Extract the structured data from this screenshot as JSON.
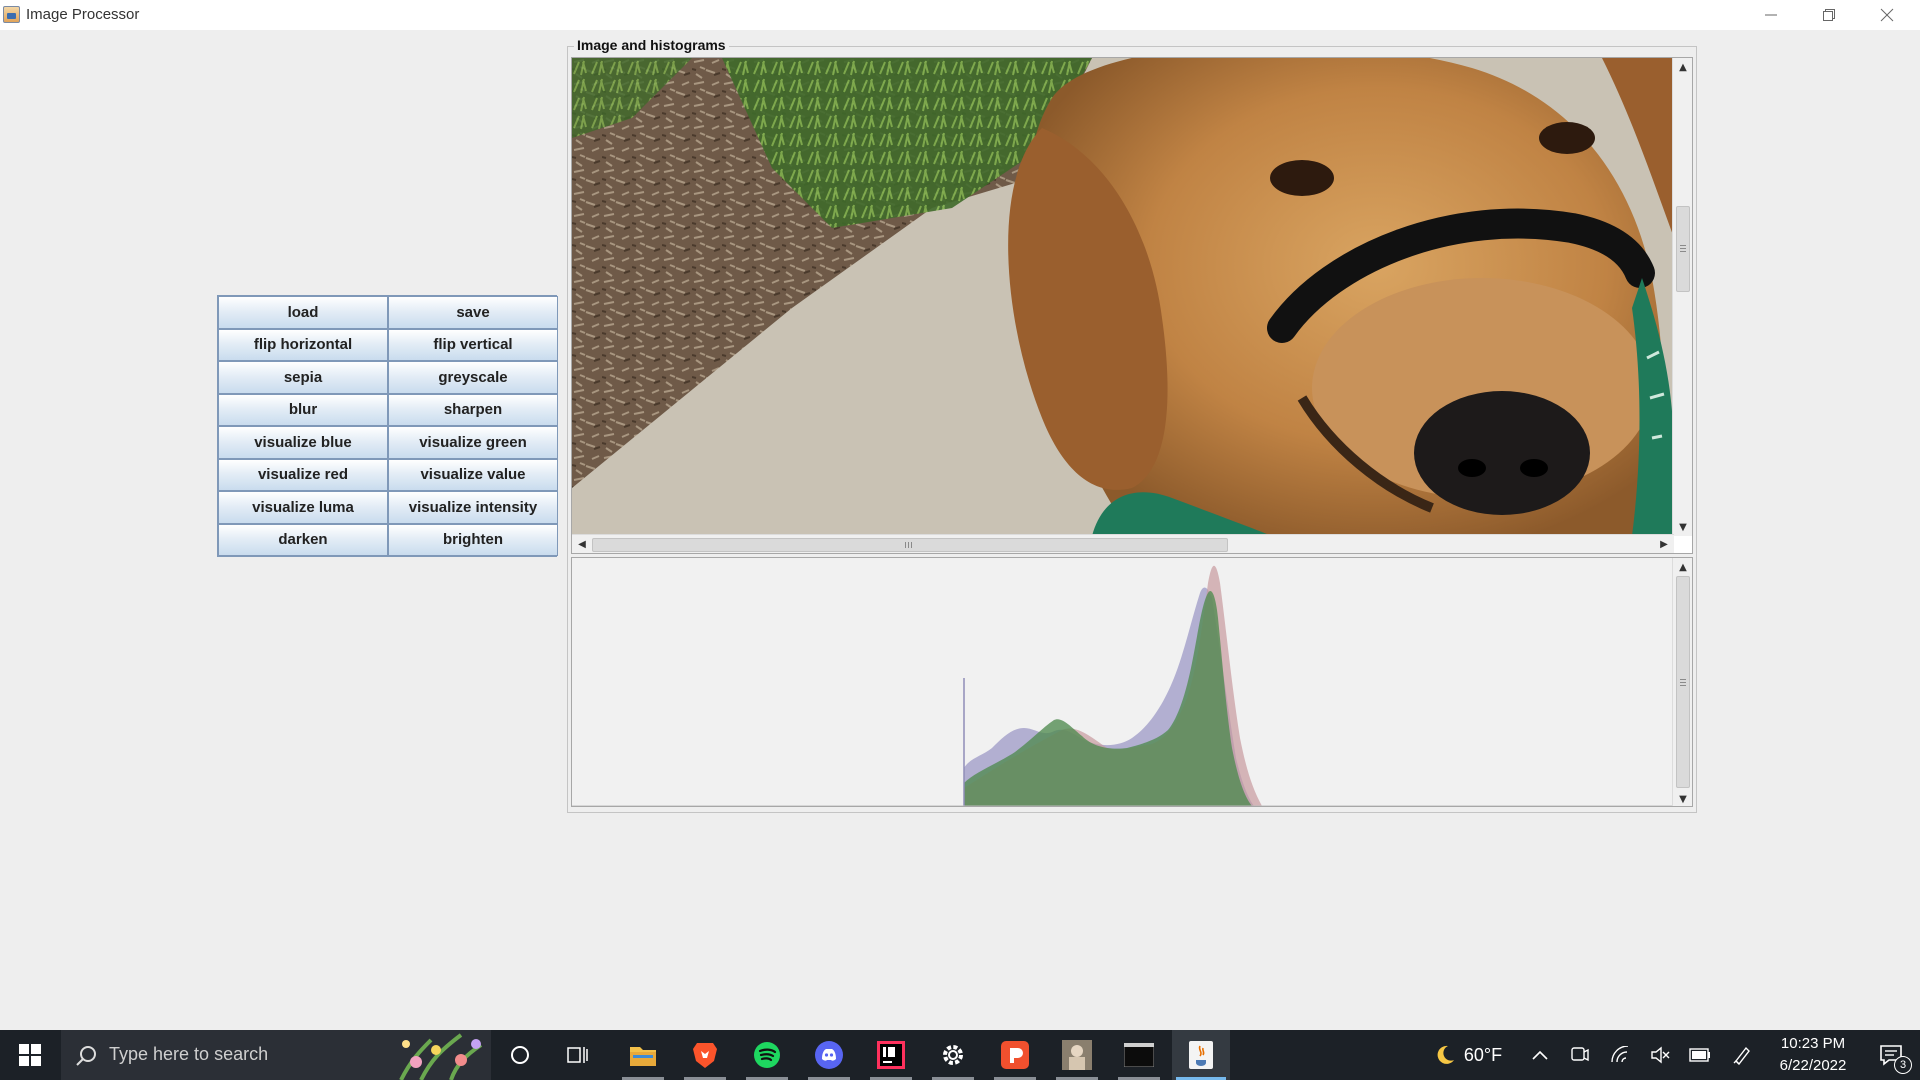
{
  "window": {
    "title": "Image Processor"
  },
  "operations": [
    {
      "label": "load"
    },
    {
      "label": "save"
    },
    {
      "label": "flip horizontal"
    },
    {
      "label": "flip vertical"
    },
    {
      "label": "sepia"
    },
    {
      "label": "greyscale"
    },
    {
      "label": "blur"
    },
    {
      "label": "sharpen"
    },
    {
      "label": "visualize blue"
    },
    {
      "label": "visualize green"
    },
    {
      "label": "visualize red"
    },
    {
      "label": "visualize value"
    },
    {
      "label": "visualize luma"
    },
    {
      "label": "visualize intensity"
    },
    {
      "label": "darken"
    },
    {
      "label": "brighten"
    }
  ],
  "panel": {
    "title": "Image and histograms"
  },
  "histogram": {
    "colors": {
      "red": "#c79a9e",
      "green": "#4f8a4f",
      "blue": "#9c98c6",
      "overlap": "#5a7a5e"
    }
  },
  "taskbar": {
    "search_placeholder": "Type here to search",
    "weather_temp": "60°F",
    "time": "10:23 PM",
    "date": "6/22/2022",
    "notification_count": "3",
    "apps": [
      "cortana-icon",
      "task-view-icon",
      "file-explorer-icon",
      "brave-icon",
      "spotify-icon",
      "discord-icon",
      "intellij-icon",
      "settings-icon",
      "office-icon",
      "photo-app-icon",
      "terminal-icon",
      "java-icon"
    ]
  }
}
